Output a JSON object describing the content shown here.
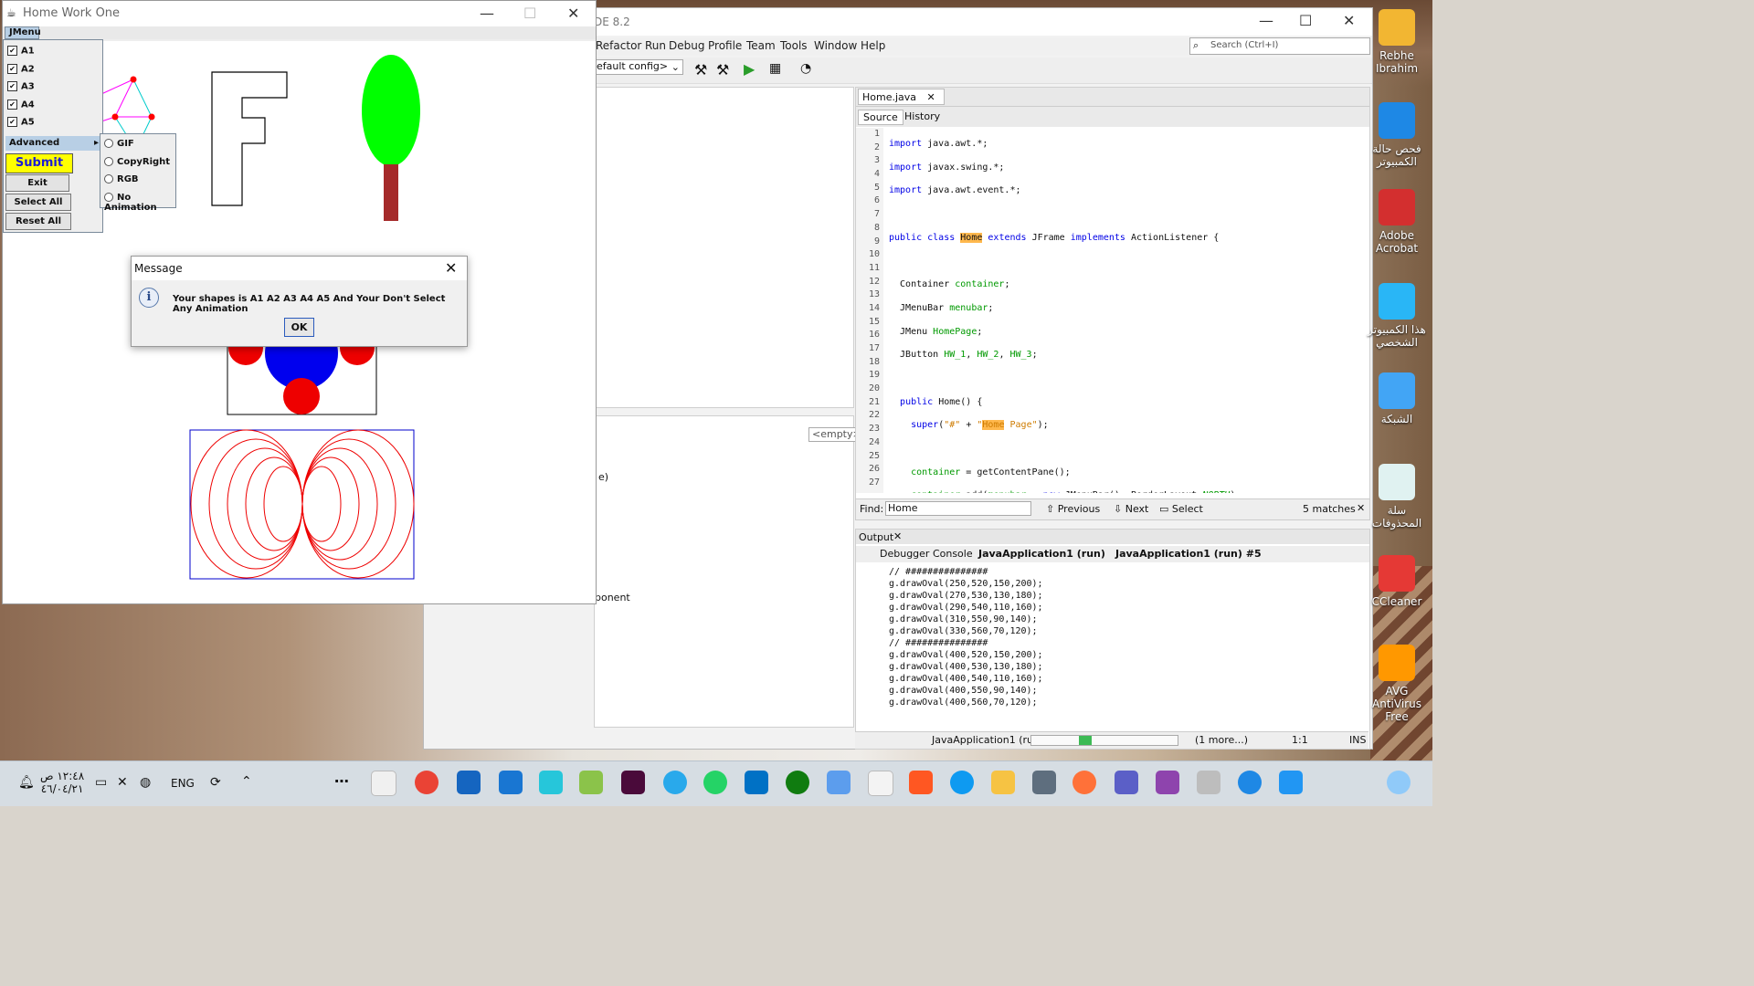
{
  "ide": {
    "title_fragment": "DE 8.2",
    "menus": [
      "Refactor",
      "Run",
      "Debug",
      "Profile",
      "Team",
      "Tools",
      "Window",
      "Help"
    ],
    "search_placeholder": "Search (Ctrl+I)",
    "config_value": "efault config>",
    "combo_empty": "<empty>",
    "partial_text_1": "e)",
    "partial_text_2": "ponent",
    "editor_tab": "Home.java",
    "source_tab": "Source",
    "history_tab": "History",
    "line_numbers": [
      "1",
      "2",
      "3",
      "4",
      "5",
      "6",
      "7",
      "8",
      "9",
      "10",
      "11",
      "12",
      "13",
      "14",
      "15",
      "16",
      "17",
      "18",
      "19",
      "20",
      "21",
      "22",
      "23",
      "24",
      "25",
      "26",
      "27"
    ],
    "find_label": "Find:",
    "find_value": "Home",
    "find_previous": "Previous",
    "find_next": "Next",
    "find_select": "Select",
    "find_matches": "5 matches",
    "output_label": "Output",
    "output_tabs": [
      "Debugger Console",
      "JavaApplication1 (run)",
      "JavaApplication1 (run) #5"
    ],
    "output_lines": [
      "// ###############",
      "g.drawOval(250,520,150,200);",
      "g.drawOval(270,530,130,180);",
      "g.drawOval(290,540,110,160);",
      "g.drawOval(310,550,90,140);",
      "g.drawOval(330,560,70,120);",
      "// ###############",
      "g.drawOval(400,520,150,200);",
      "g.drawOval(400,530,130,180);",
      "g.drawOval(400,540,110,160);",
      "g.drawOval(400,550,90,140);",
      "g.drawOval(400,560,70,120);"
    ],
    "status_task": "JavaApplication1 (run)",
    "status_more": "(1 more...)",
    "status_pos": "1:1",
    "status_mode": "INS"
  },
  "swing": {
    "title": "Home Work One",
    "menu": "JMenu",
    "checks": [
      "A1",
      "A2",
      "A3",
      "A4",
      "A5"
    ],
    "advanced": "Advanced",
    "submit": "Submit",
    "exit": "Exit",
    "select_all": "Select All",
    "reset_all": "Reset All",
    "radios": [
      "GIF",
      "CopyRight",
      "RGB",
      "No Animation"
    ]
  },
  "dialog": {
    "title": "Message",
    "icon": "i",
    "message": "Your shapes is A1 A2 A3 A4 A5 And Your Don't Select Any Animation",
    "ok": "OK"
  },
  "desktop": {
    "icons": [
      "Rebhe Ibrahim",
      "فحص حالة الكمبيوتر",
      "Adobe Acrobat",
      "هذا الكمبيوتر الشخصي",
      "الشبكة",
      "سلة المحذوفات",
      "CCleaner",
      "AVG AntiVirus Free"
    ]
  },
  "taskbar": {
    "time": "١٢:٤٨ ص",
    "date": "٤٦/٠٤/٢١",
    "lang": "ENG",
    "more": "⋯"
  },
  "colors": {
    "accent": "#2a5bbd",
    "highlight": "#ffb84d",
    "submit_bg": "#ffff00",
    "tree_top": "#00ff00",
    "tree_trunk": "#a52a2a"
  }
}
